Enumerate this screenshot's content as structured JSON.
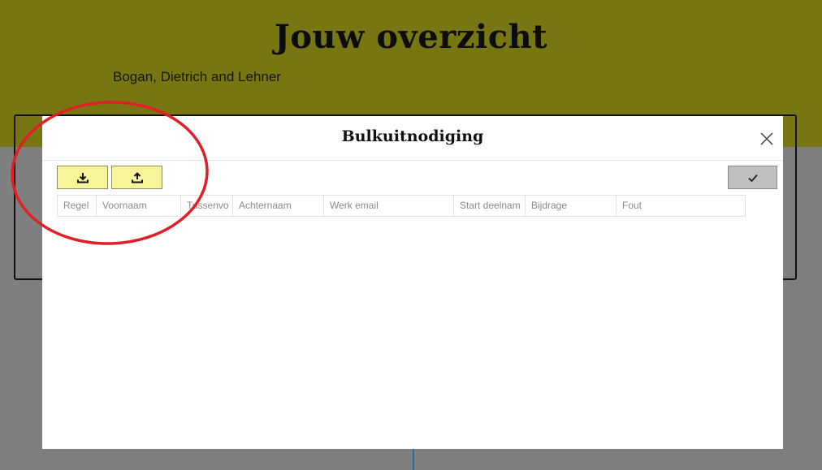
{
  "background_page": {
    "title": "Jouw overzicht",
    "subtitle": "Bogan, Dietrich and Lehner"
  },
  "modal": {
    "title": "Bulkuitnodiging",
    "toolbar": {
      "download_icon": "download-icon",
      "upload_icon": "upload-icon",
      "confirm_icon": "checkmark-icon"
    },
    "table": {
      "columns": [
        "Regel",
        "Voornaam",
        "Tussenvo",
        "Achternaam",
        "Werk email",
        "Start deelnam",
        "Bijdrage",
        "Fout"
      ],
      "rows": []
    }
  },
  "colors": {
    "header_olive": "#787613",
    "button_yellow": "#f8f49a",
    "confirm_grey": "#bfbfbf",
    "overlay_grey": "#7f7f7f",
    "annotation_red": "#e01f26"
  }
}
